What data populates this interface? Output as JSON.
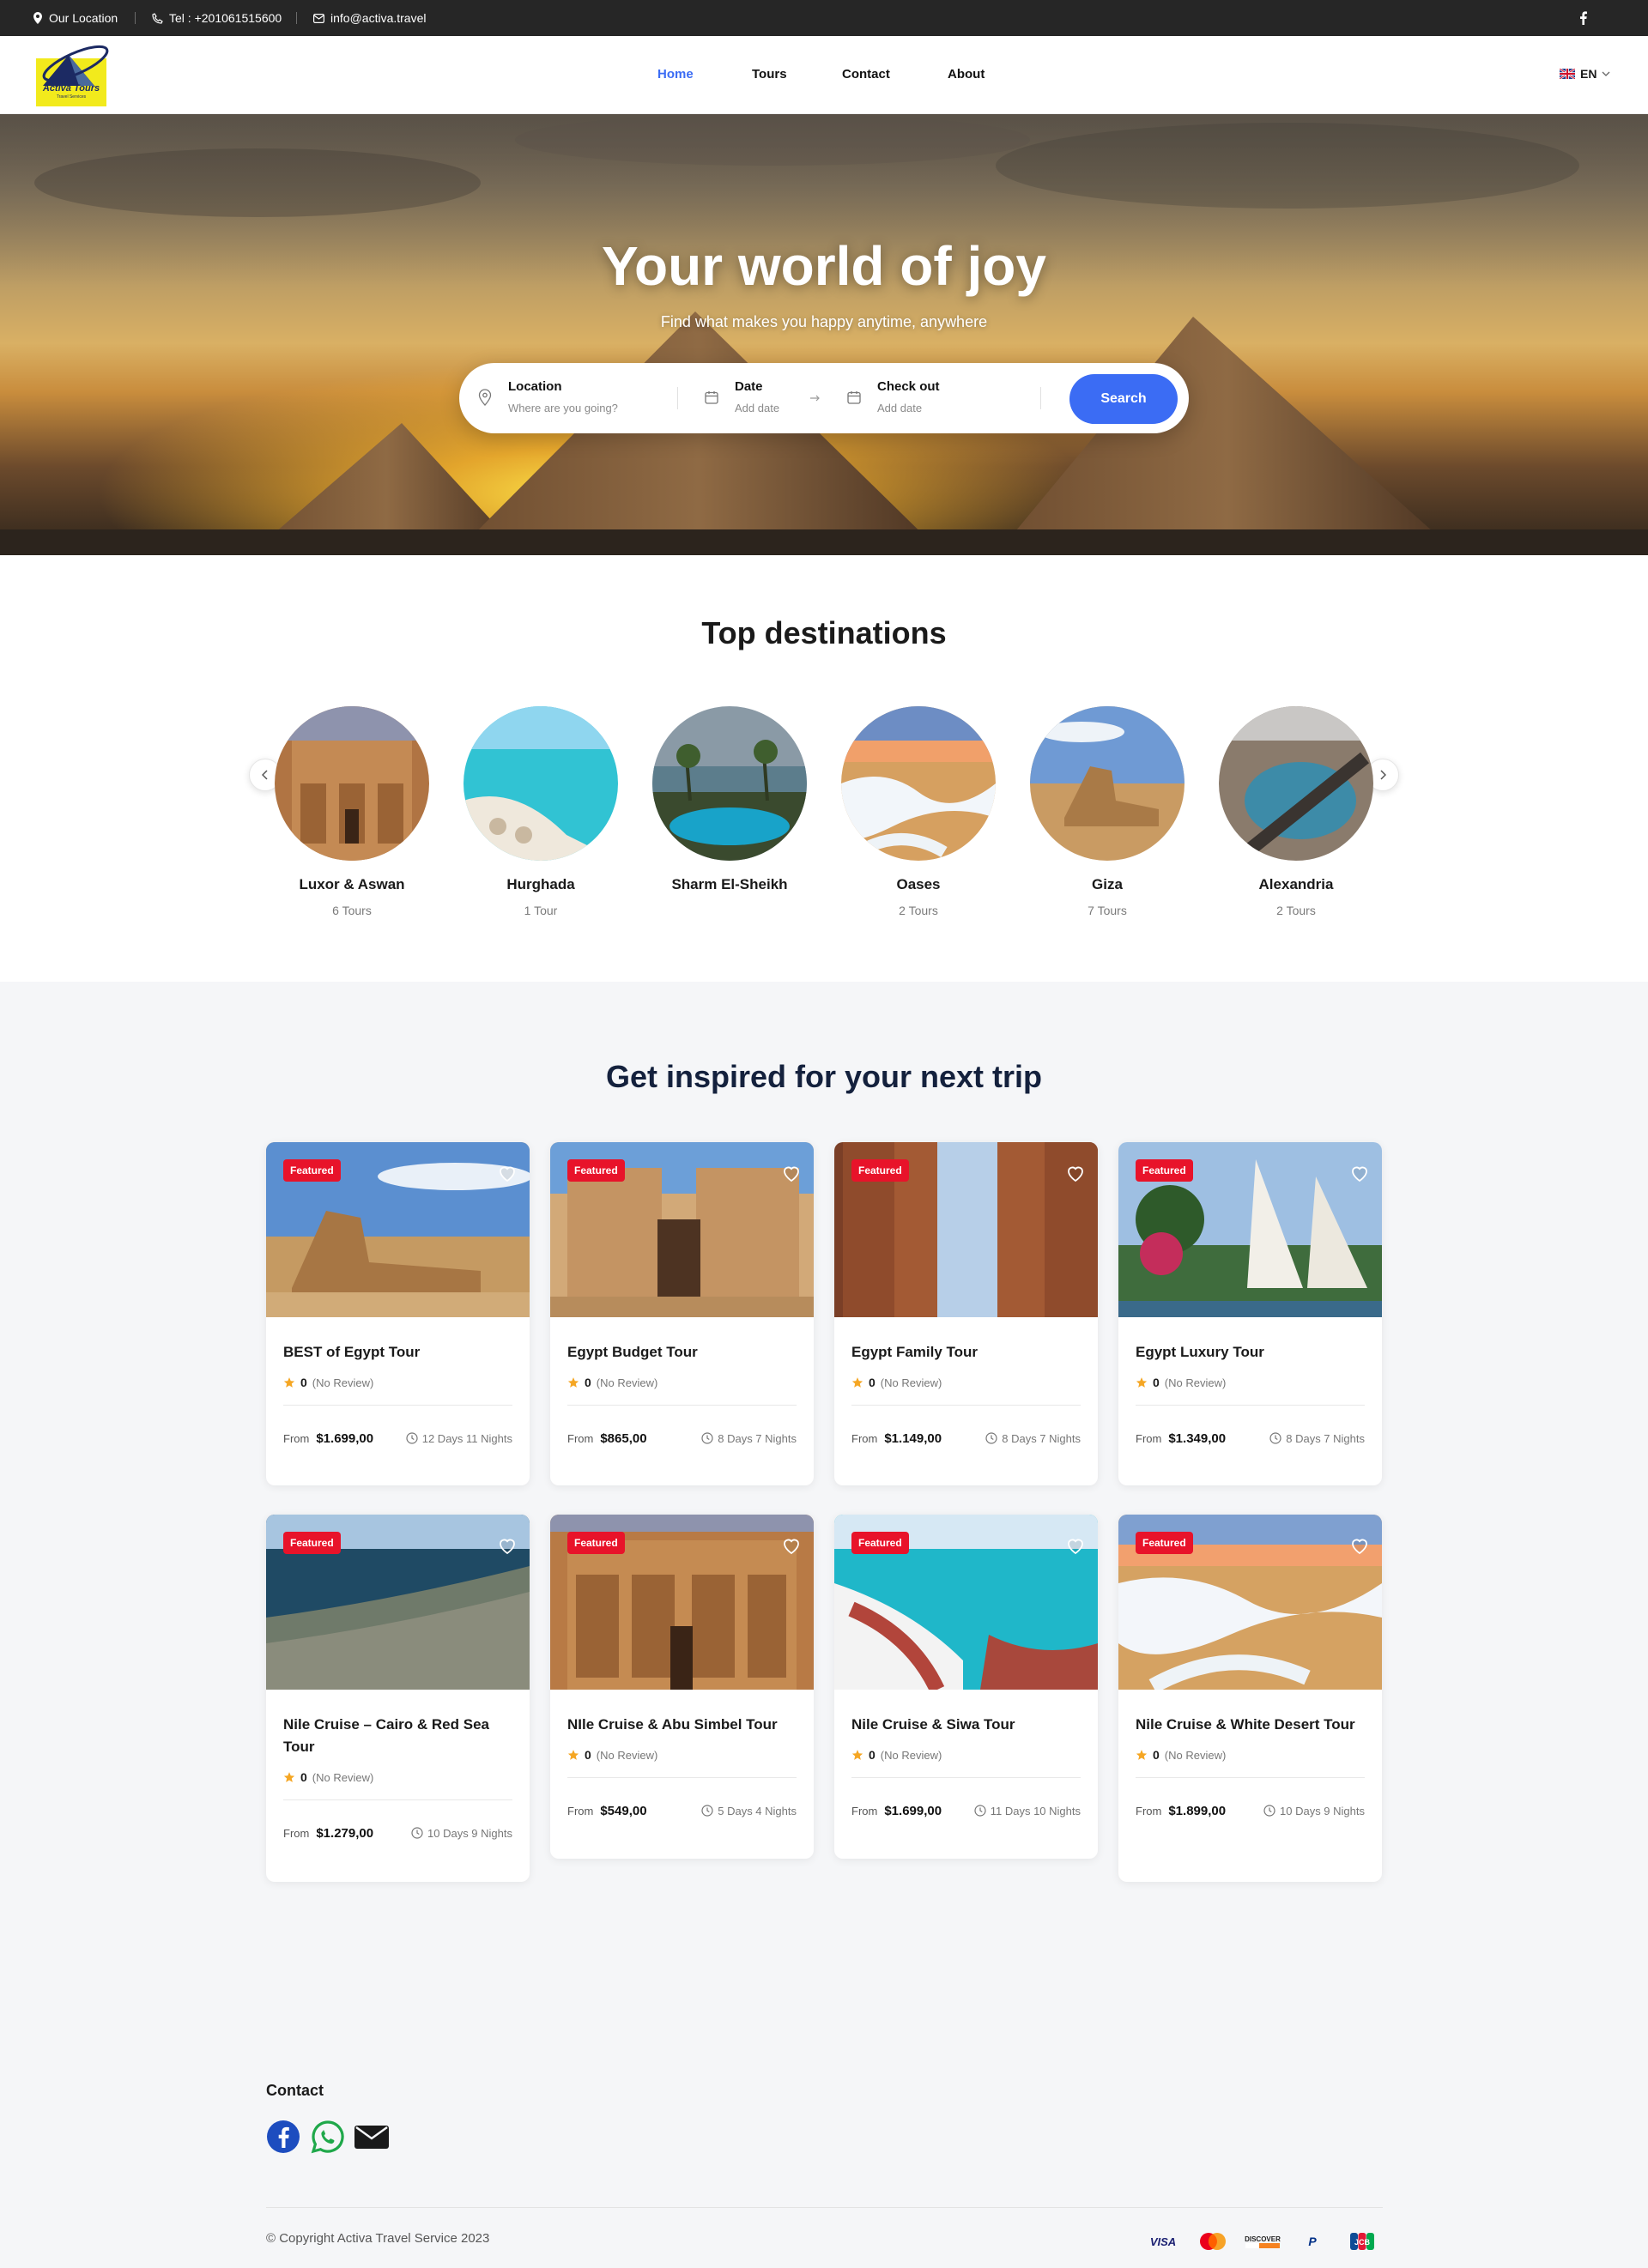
{
  "topbar": {
    "location": "Our Location",
    "phone": "Tel : +201061515600",
    "email": "info@activa.travel",
    "facebook_icon": "facebook-icon"
  },
  "brand": {
    "logo_line1": "Activa Tours",
    "logo_line2": "Travel Services"
  },
  "nav": {
    "items": [
      "Home",
      "Tours",
      "Contact",
      "About"
    ],
    "active": "Home",
    "active_color": "#3b6cf4",
    "language": "EN"
  },
  "hero": {
    "title": "Your world of joy",
    "subtitle": "Find what makes you happy anytime, anywhere",
    "search": {
      "location_label": "Location",
      "location_placeholder": "Where are you going?",
      "date_label": "Date",
      "date_placeholder": "Add date",
      "checkout_label": "Check out",
      "checkout_placeholder": "Add date",
      "button": "Search",
      "button_color": "#3b6cf4"
    }
  },
  "destinations": {
    "title": "Top destinations",
    "items": [
      {
        "name": "Luxor & Aswan",
        "count": "6 Tours"
      },
      {
        "name": "Hurghada",
        "count": "1 Tour"
      },
      {
        "name": "Sharm El-Sheikh",
        "count": ""
      },
      {
        "name": "Oases",
        "count": "2 Tours"
      },
      {
        "name": "Giza",
        "count": "7 Tours"
      },
      {
        "name": "Alexandria",
        "count": "2 Tours"
      }
    ]
  },
  "tours": {
    "title": "Get inspired for your next trip",
    "badge": "Featured",
    "badge_color": "#e8132a",
    "from_label": "From",
    "items": [
      {
        "title": "BEST of Egypt Tour",
        "rating": "0",
        "reviews": "(No Review)",
        "price": "$1.699,00",
        "duration": "12 Days 11 Nights"
      },
      {
        "title": "Egypt Budget Tour",
        "rating": "0",
        "reviews": "(No Review)",
        "price": "$865,00",
        "duration": "8 Days 7 Nights"
      },
      {
        "title": "Egypt Family Tour",
        "rating": "0",
        "reviews": "(No Review)",
        "price": "$1.149,00",
        "duration": "8 Days 7 Nights"
      },
      {
        "title": "Egypt Luxury Tour",
        "rating": "0",
        "reviews": "(No Review)",
        "price": "$1.349,00",
        "duration": "8 Days 7 Nights"
      },
      {
        "title": "Nile Cruise – Cairo & Red Sea Tour",
        "rating": "0",
        "reviews": "(No Review)",
        "price": "$1.279,00",
        "duration": "10 Days 9 Nights"
      },
      {
        "title": "NIle Cruise & Abu Simbel Tour",
        "rating": "0",
        "reviews": "(No Review)",
        "price": "$549,00",
        "duration": "5 Days 4 Nights"
      },
      {
        "title": "Nile Cruise & Siwa Tour",
        "rating": "0",
        "reviews": "(No Review)",
        "price": "$1.699,00",
        "duration": "11 Days 10 Nights"
      },
      {
        "title": "Nile Cruise & White Desert Tour",
        "rating": "0",
        "reviews": "(No Review)",
        "price": "$1.899,00",
        "duration": "10 Days 9 Nights"
      }
    ]
  },
  "footer": {
    "contact_title": "Contact",
    "social": [
      "facebook-icon",
      "whatsapp-icon",
      "email-icon"
    ],
    "copyright": "© Copyright Activa Travel Service 2023",
    "payments": [
      {
        "name": "VISA",
        "icon": "visa-icon"
      },
      {
        "name": "",
        "icon": "mastercard-icon"
      },
      {
        "name": "DISCOVER",
        "icon": "discover-icon"
      },
      {
        "name": "P",
        "icon": "paypal-icon"
      },
      {
        "name": "JCB",
        "icon": "jcb-icon"
      }
    ]
  }
}
